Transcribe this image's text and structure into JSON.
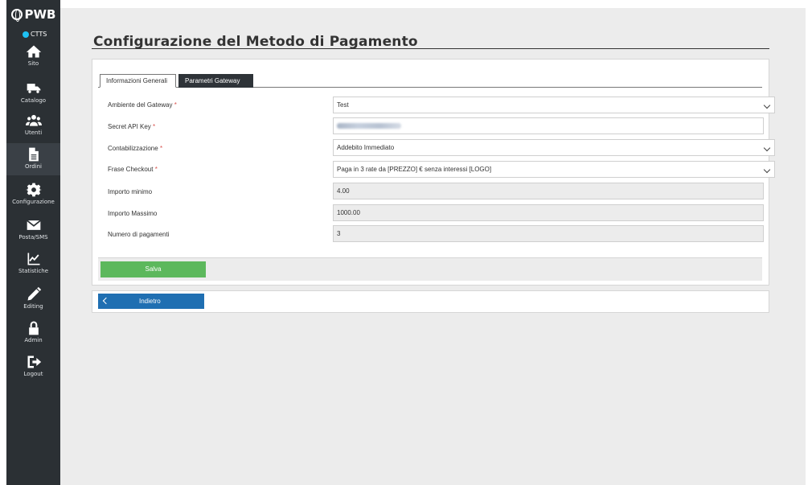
{
  "brand": {
    "logo_text": "PWB",
    "site_code": "CTTS",
    "site_dot_color": "#1ec1f3"
  },
  "sidebar": {
    "items": [
      {
        "label": "Sito",
        "icon": "home-icon"
      },
      {
        "label": "Catalogo",
        "icon": "truck-icon"
      },
      {
        "label": "Utenti",
        "icon": "users-icon"
      },
      {
        "label": "Ordini",
        "icon": "document-icon",
        "active": true
      },
      {
        "label": "Configurazione",
        "icon": "gear-icon"
      },
      {
        "label": "Posta/SMS",
        "icon": "envelope-icon"
      },
      {
        "label": "Statistiche",
        "icon": "chart-icon"
      },
      {
        "label": "Editing",
        "icon": "pencil-icon"
      },
      {
        "label": "Admin",
        "icon": "lock-icon"
      },
      {
        "label": "Logout",
        "icon": "logout-icon"
      }
    ]
  },
  "page": {
    "title": "Configurazione del Metodo di Pagamento"
  },
  "tabs": [
    {
      "label": "Informazioni Generali",
      "active": false
    },
    {
      "label": "Parametri Gateway",
      "active": true
    }
  ],
  "form": {
    "rows": [
      {
        "label": "Ambiente del Gateway",
        "required": "*",
        "type": "select",
        "value": "Test"
      },
      {
        "label": "Secret API Key",
        "required": "*",
        "type": "masked",
        "value": ""
      },
      {
        "label": "Contabilizzazione",
        "required": "*",
        "type": "select",
        "value": "Addebito Immediato"
      },
      {
        "label": "Frase Checkout",
        "required": "*",
        "type": "select",
        "value": "Paga in 3 rate da [PREZZO] € senza interessi [LOGO]"
      },
      {
        "label": "Importo minimo",
        "required": "",
        "type": "readonly",
        "value": "4.00"
      },
      {
        "label": "Importo Massimo",
        "required": "",
        "type": "readonly",
        "value": "1000.00"
      },
      {
        "label": "Numero di pagamenti",
        "required": "",
        "type": "readonly",
        "value": "3"
      }
    ]
  },
  "actions": {
    "save_label": "Salva",
    "back_label": "Indietro"
  },
  "colors": {
    "save": "#5cb85c",
    "back": "#1f6fb2",
    "sidebar": "#2b3034",
    "required": "#d9534f"
  }
}
